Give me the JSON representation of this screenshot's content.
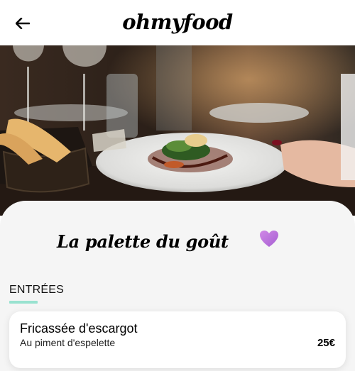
{
  "header": {
    "back_icon": "arrow-left-icon",
    "app_name": "ohmyfood"
  },
  "hero": {
    "image_subject": "plated gourmet dish on restaurant table"
  },
  "restaurant": {
    "name": "La palette du goût",
    "favorite_icon": "heart-icon",
    "favorite_color": "#c77ee0"
  },
  "menu": {
    "section_title": "ENTRÉES",
    "accent_color": "#99e2d0",
    "items": [
      {
        "name": "Fricassée d'escargot",
        "description": "Au piment d'espelette",
        "price": "25€"
      }
    ]
  }
}
